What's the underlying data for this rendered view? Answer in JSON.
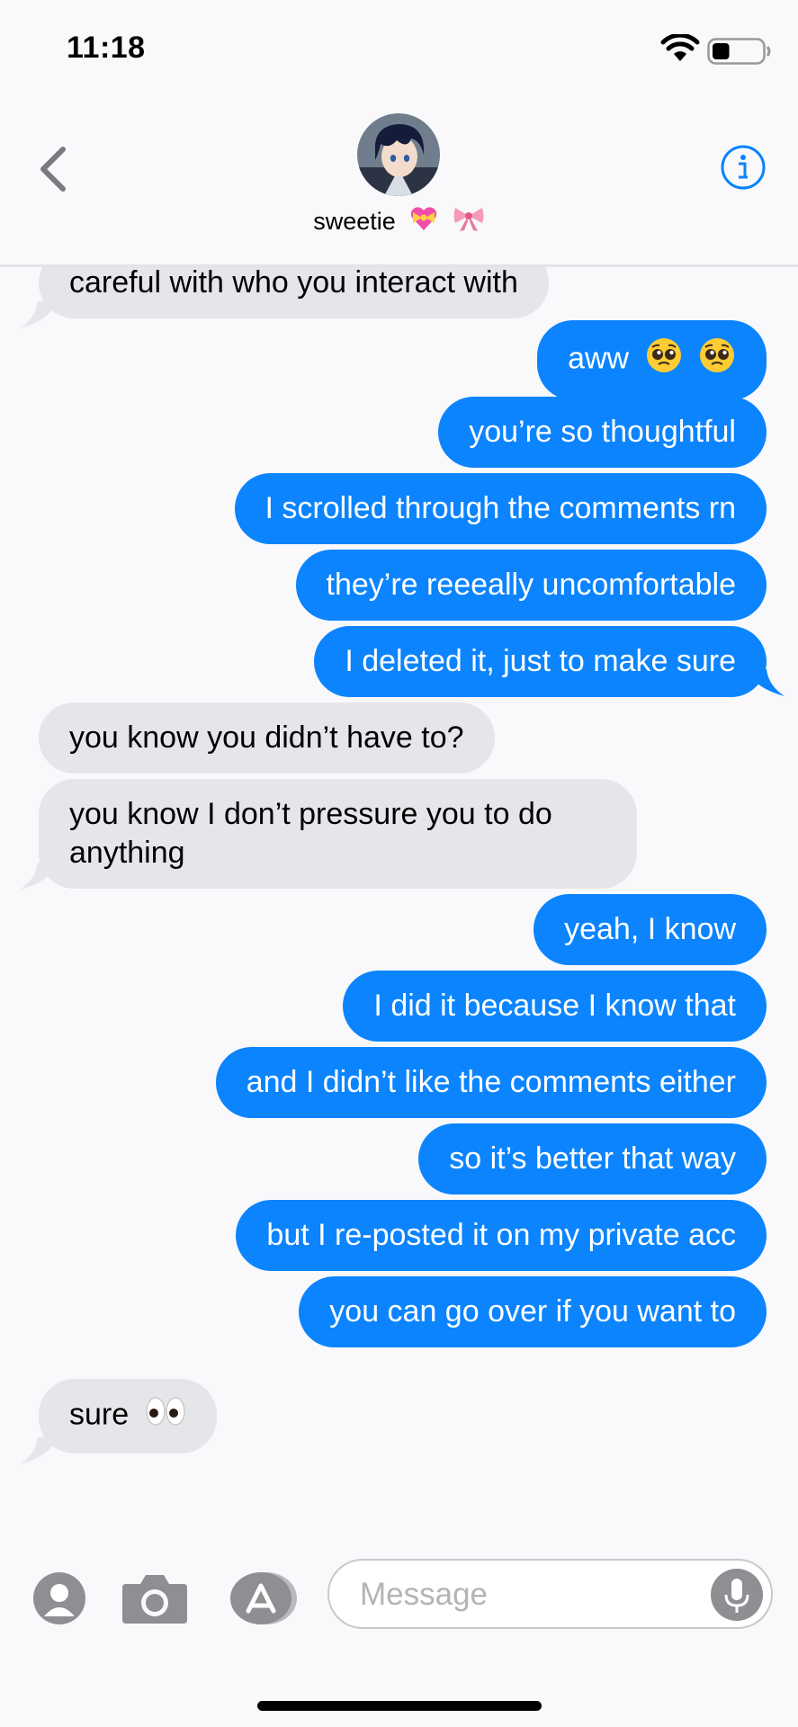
{
  "status_bar": {
    "time": "11:18",
    "wifi_icon": "wifi-icon",
    "battery_icon": "battery-icon",
    "battery_level": 0.35
  },
  "header": {
    "back_icon": "chevron-left-icon",
    "contact_name": "sweetie",
    "contact_emojis": [
      "heart-with-ribbon",
      "bow-ribbon"
    ],
    "info_icon": "info-icon"
  },
  "messages": [
    {
      "side": "received",
      "text": "careful with who you interact with"
    },
    {
      "side": "sent",
      "text": "aww",
      "emojis": [
        "pleading-face",
        "pleading-face"
      ]
    },
    {
      "side": "sent",
      "text": "you’re so thoughtful"
    },
    {
      "side": "sent",
      "text": "I scrolled through the comments rn"
    },
    {
      "side": "sent",
      "text": "they’re reeeally uncomfortable"
    },
    {
      "side": "sent",
      "text": "I deleted it, just to make sure"
    },
    {
      "side": "received",
      "text": "you know you didn’t have to?"
    },
    {
      "side": "received",
      "text": "you know I don’t pressure you to do anything"
    },
    {
      "side": "sent",
      "text": "yeah, I know"
    },
    {
      "side": "sent",
      "text": "I did it because I know that"
    },
    {
      "side": "sent",
      "text": "and I didn’t like the comments either"
    },
    {
      "side": "sent",
      "text": "so it’s better that way"
    },
    {
      "side": "sent",
      "text": "but I re-posted it on my private acc"
    },
    {
      "side": "sent",
      "text": "you can go over if you want to"
    },
    {
      "side": "received",
      "text": "sure",
      "emojis": [
        "eyes"
      ]
    }
  ],
  "compose": {
    "contact_icon": "contact-icon",
    "camera_icon": "camera-icon",
    "appstore_icon": "app-store-icon",
    "placeholder": "Message",
    "mic_icon": "microphone-icon"
  },
  "colors": {
    "sent_bubble": "#0b84fe",
    "received_bubble": "#e6e5ea",
    "accent": "#0b84fe"
  }
}
